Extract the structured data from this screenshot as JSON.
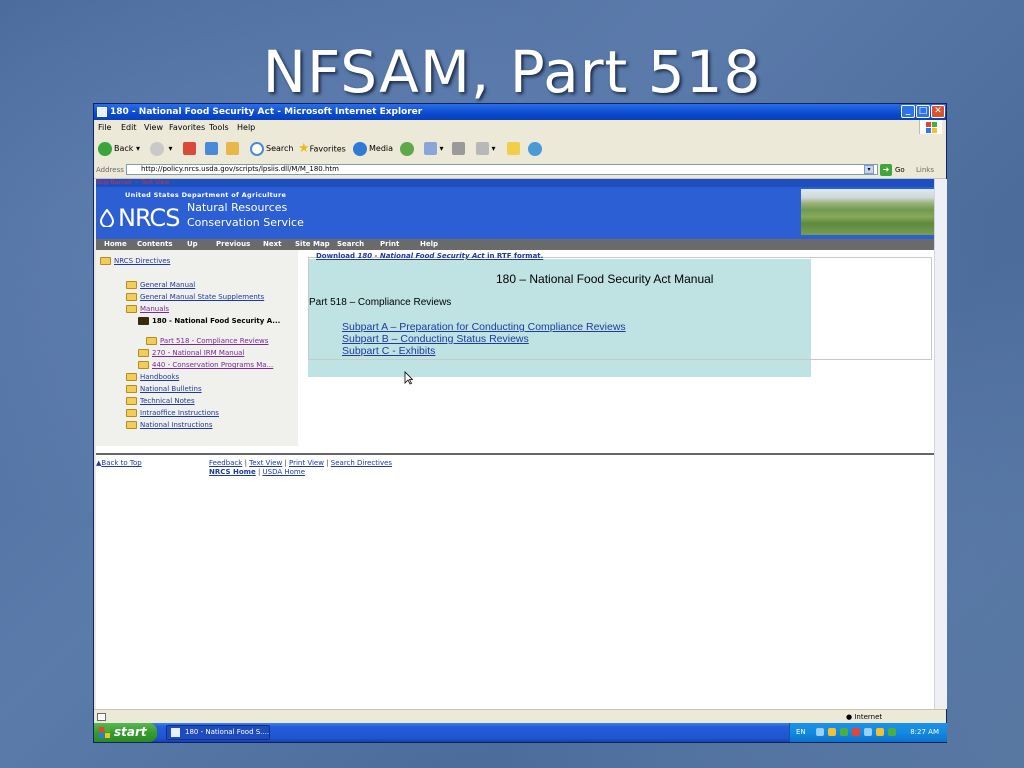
{
  "slide": {
    "title": "NFSAM, Part 518"
  },
  "window": {
    "title": "180 - National Food Security Act - Microsoft Internet Explorer",
    "controls": {
      "minimize": "_",
      "maximize": "□",
      "close": "✕"
    }
  },
  "menu": [
    "File",
    "Edit",
    "View",
    "Favorites",
    "Tools",
    "Help"
  ],
  "toolbar": {
    "back": "Back",
    "search": "Search",
    "favorites": "Favorites",
    "media": "Media"
  },
  "address": {
    "label": "Address",
    "url": "http://policy.nrcs.usda.gov/scripts/lpsiis.dll/M/M_180.htm",
    "go": "Go",
    "links": "Links"
  },
  "page": {
    "skip_banner": "Skip Banner",
    "text_view_top": "Text View",
    "dept": "United States Department of Agriculture",
    "logo": "NRCS",
    "agency_line1": "Natural Resources",
    "agency_line2": "Conservation Service",
    "nav": [
      "Home",
      "Contents",
      "Up",
      "Previous",
      "Next",
      "Site Map",
      "Search",
      "Print",
      "Help"
    ],
    "tree": [
      {
        "label": "NRCS Directives",
        "state": "link"
      },
      {
        "label": "General Manual",
        "state": "link"
      },
      {
        "label": "General Manual State Supplements",
        "state": "link"
      },
      {
        "label": "Manuals",
        "state": "visited"
      },
      {
        "label": "180 - National Food Security A...",
        "state": "active"
      },
      {
        "label": "Part 518 - Compliance Reviews",
        "state": "visited"
      },
      {
        "label": "270 - National IRM Manual",
        "state": "visited"
      },
      {
        "label": "440 - Conservation Programs Ma...",
        "state": "visited"
      },
      {
        "label": "Handbooks",
        "state": "link"
      },
      {
        "label": "National Bulletins",
        "state": "link"
      },
      {
        "label": "Technical Notes",
        "state": "link"
      },
      {
        "label": "Intraoffice Instructions",
        "state": "link"
      },
      {
        "label": "National Instructions",
        "state": "link"
      }
    ],
    "rtf": {
      "prefix": "Download ",
      "title": "180 - National Food Security Act",
      "suffix": " in RTF format."
    },
    "manual_title": "180 – National Food Security Act Manual",
    "part_title": "Part 518 – Compliance Reviews",
    "subparts": [
      "Subpart A – Preparation for Conducting Compliance Reviews",
      "Subpart B – Conducting Status Reviews",
      "Subpart C - Exhibits"
    ],
    "footer": {
      "back_to_top": "Back to Top",
      "feedback": "Feedback",
      "text_view": "Text View",
      "print_view": "Print View",
      "search_directives": "Search Directives",
      "nrcs_home": "NRCS Home",
      "usda_home": "USDA Home",
      "sep": "|"
    }
  },
  "status": {
    "zone": "Internet"
  },
  "taskbar": {
    "start": "start",
    "task": "180 - National Food S....",
    "lang": "EN",
    "time": "8:27 AM"
  }
}
